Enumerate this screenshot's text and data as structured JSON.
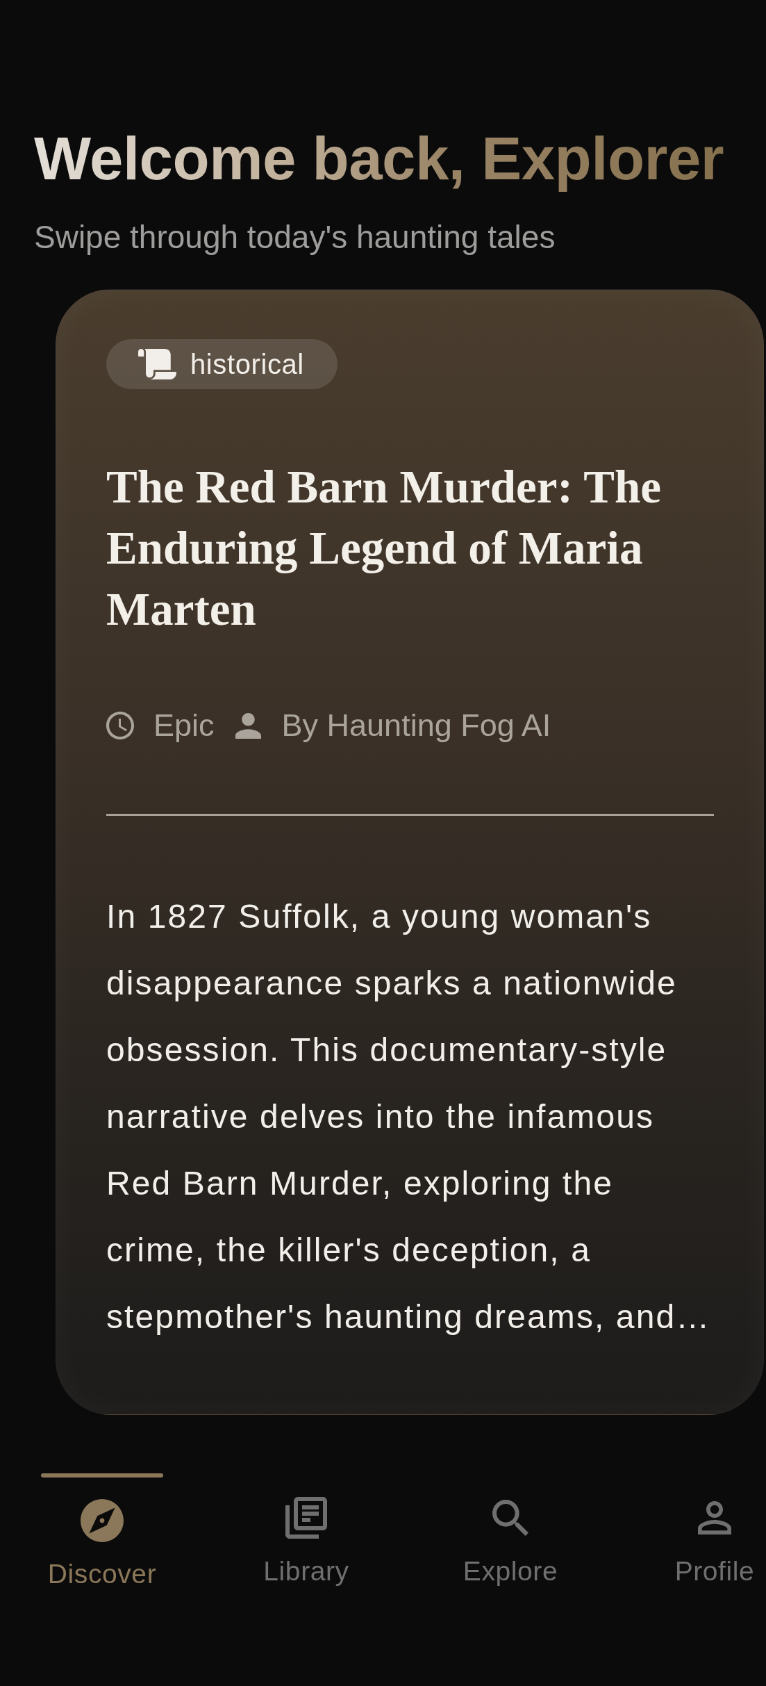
{
  "header": {
    "title": "Welcome back, Explorer",
    "subtitle": "Swipe through today's haunting tales"
  },
  "story_card": {
    "genre": "historical",
    "title": "The Red Barn Murder: The Enduring Legend of Maria Marten",
    "length": "Epic",
    "author": "By Haunting Fog AI",
    "summary": "In 1827 Suffolk, a young woman's disappearance sparks a nationwide obsession. This documentary-style narrative delves into the infamous Red Barn Murder, exploring the crime, the killer's deception, a stepmother's haunting dreams, and…"
  },
  "bottom_nav": [
    {
      "label": "Discover",
      "selected": true
    },
    {
      "label": "Library",
      "selected": false
    },
    {
      "label": "Explore",
      "selected": false
    },
    {
      "label": "Profile",
      "selected": false
    }
  ]
}
